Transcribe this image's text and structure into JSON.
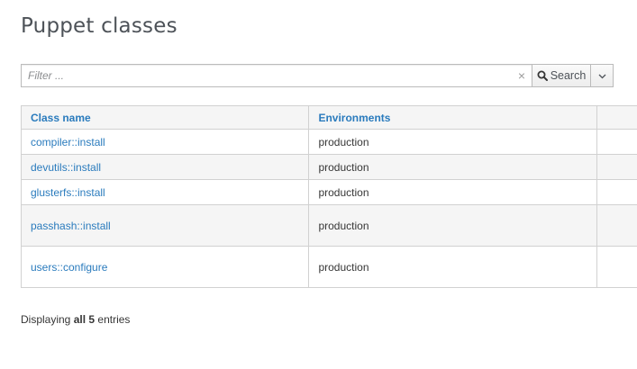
{
  "page": {
    "title": "Puppet classes"
  },
  "search": {
    "placeholder": "Filter ...",
    "value": "",
    "clear_glyph": "×",
    "button_label": "Search",
    "search_icon": "search-icon",
    "dropdown_icon": "chevron-down-icon"
  },
  "table": {
    "headers": {
      "class_name": "Class name",
      "environments": "Environments"
    },
    "rows": [
      {
        "class_name": "compiler::install",
        "environments": "production"
      },
      {
        "class_name": "devutils::install",
        "environments": "production"
      },
      {
        "class_name": "glusterfs::install",
        "environments": "production"
      },
      {
        "class_name": "passhash::install",
        "environments": "production"
      },
      {
        "class_name": "users::configure",
        "environments": "production"
      }
    ]
  },
  "footer": {
    "prefix": "Displaying",
    "count_label": "all 5",
    "suffix": "entries"
  },
  "colors": {
    "link": "#2a7bbd",
    "border": "#d1d1d1",
    "stripe": "#f5f5f5"
  }
}
